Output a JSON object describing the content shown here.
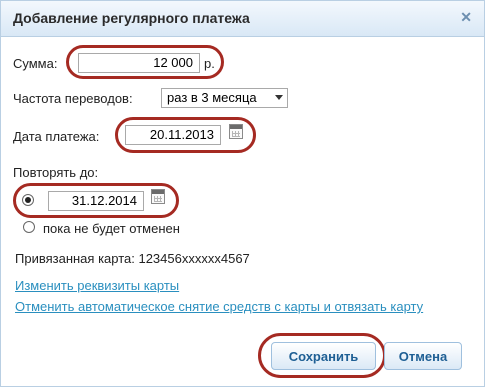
{
  "dialog": {
    "title": "Добавление регулярного платежа",
    "close_icon": "close-icon"
  },
  "form": {
    "amount_label": "Сумма:",
    "amount_value": "12 000",
    "currency": "р.",
    "frequency_label": "Частота переводов:",
    "frequency_selected": "раз в 3 месяца",
    "date_label": "Дата платежа:",
    "date_value": "20.11.2013",
    "repeat_label": "Повторять до:",
    "repeat_until_value": "31.12.2014",
    "repeat_option_until_cancel": "пока не будет отменен",
    "card_label": "Привязанная карта: 123456xxxxxx4567"
  },
  "links": {
    "change_details": "Изменить реквизиты карты",
    "cancel_auto": "Отменить автоматическое снятие средств с карты и отвязать карту"
  },
  "buttons": {
    "save": "Сохранить",
    "cancel": "Отмена"
  },
  "colors": {
    "highlight_ring": "#a52a22",
    "link": "#2a8fbf",
    "button_text": "#1e5f94"
  }
}
